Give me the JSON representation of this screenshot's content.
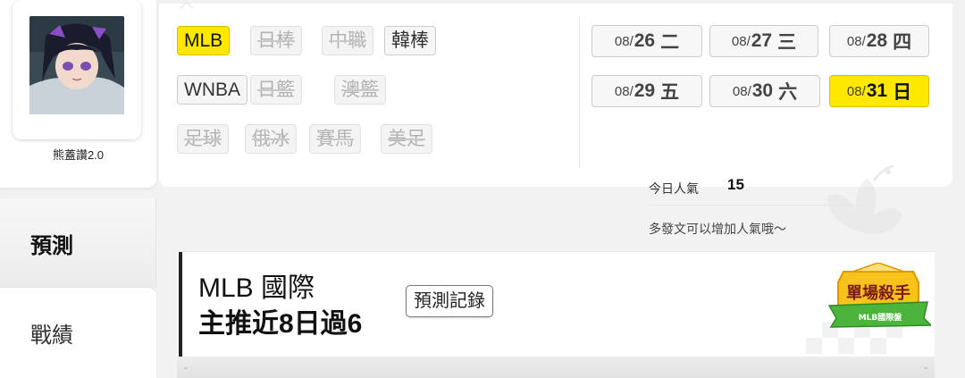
{
  "user": {
    "name": "熊蓋讚2.0"
  },
  "nav": {
    "predict": "預測",
    "record": "戰績"
  },
  "leagues": [
    {
      "label": "MLB",
      "state": "active"
    },
    {
      "label": "日棒",
      "state": "disabled"
    },
    {
      "label": "中職",
      "state": "disabled"
    },
    {
      "label": "韓棒",
      "state": "normal"
    },
    {
      "label": "WNBA",
      "state": "normal"
    },
    {
      "label": "日籃",
      "state": "disabled"
    },
    {
      "label": "澳籃",
      "state": "disabled"
    },
    {
      "label": "足球",
      "state": "disabled"
    },
    {
      "label": "俄冰",
      "state": "disabled"
    },
    {
      "label": "賽馬",
      "state": "disabled"
    },
    {
      "label": "美足",
      "state": "disabled"
    }
  ],
  "dates": [
    {
      "md": "08/",
      "day": "26",
      "weekday": "二",
      "active": false
    },
    {
      "md": "08/",
      "day": "27",
      "weekday": "三",
      "active": false
    },
    {
      "md": "08/",
      "day": "28",
      "weekday": "四",
      "active": false
    },
    {
      "md": "08/",
      "day": "29",
      "weekday": "五",
      "active": false
    },
    {
      "md": "08/",
      "day": "30",
      "weekday": "六",
      "active": false
    },
    {
      "md": "08/",
      "day": "31",
      "weekday": "日",
      "active": true
    }
  ],
  "popularity": {
    "label": "今日人氣",
    "value": "15",
    "tip": "多發文可以增加人氣哦～"
  },
  "prediction": {
    "title": "MLB 國際",
    "subtitle": "主推近8日過6",
    "record_button": "預測記錄",
    "badge_main": "單場殺手",
    "badge_sub": "MLB國際盤"
  },
  "colors": {
    "accent_yellow": "#ffe800",
    "badge_green": "#4bb53b"
  }
}
